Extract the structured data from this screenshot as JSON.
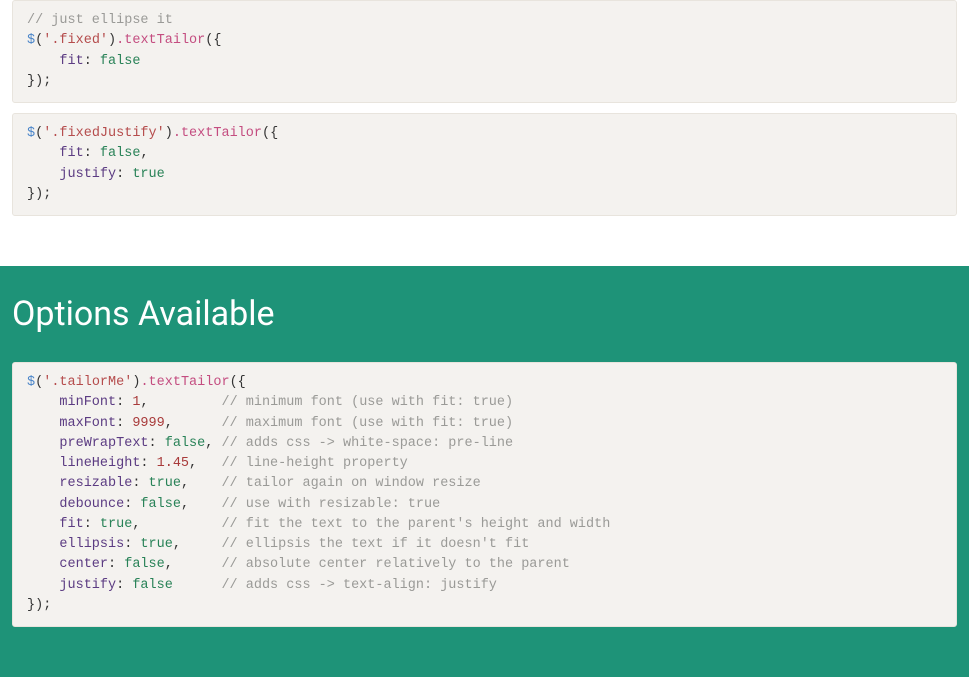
{
  "section_title": "Options Available",
  "code1": {
    "comment": "// just ellipse it",
    "func": "$",
    "selector": "'.fixed'",
    "method": ".textTailor",
    "open": "({",
    "lines": [
      {
        "prop": "fit",
        "val": "false",
        "type": "bool",
        "comma": ""
      }
    ],
    "close": "});"
  },
  "code2": {
    "func": "$",
    "selector": "'.fixedJustify'",
    "method": ".textTailor",
    "open": "({",
    "lines": [
      {
        "prop": "fit",
        "val": "false",
        "type": "bool",
        "comma": ","
      },
      {
        "prop": "justify",
        "val": "true",
        "type": "bool",
        "comma": ""
      }
    ],
    "close": "});"
  },
  "code3": {
    "func": "$",
    "selector": "'.tailorMe'",
    "method": ".textTailor",
    "open": "({",
    "lines": [
      {
        "prop": "minFont",
        "val": "1",
        "type": "num",
        "pad": "        ",
        "comma": ",",
        "comment": "// minimum font (use with fit: true)"
      },
      {
        "prop": "maxFont",
        "val": "9999",
        "type": "num",
        "pad": "     ",
        "comma": ",",
        "comment": "// maximum font (use with fit: true)"
      },
      {
        "prop": "preWrapText",
        "val": "false",
        "type": "bool",
        "pad": "",
        "comma": ",",
        "comment": "// adds css -> white-space: pre-line"
      },
      {
        "prop": "lineHeight",
        "val": "1.45",
        "type": "num",
        "pad": "  ",
        "comma": ",",
        "comment": "// line-height property"
      },
      {
        "prop": "resizable",
        "val": "true",
        "type": "bool",
        "pad": "   ",
        "comma": ",",
        "comment": "// tailor again on window resize"
      },
      {
        "prop": "debounce",
        "val": "false",
        "type": "bool",
        "pad": "   ",
        "comma": ",",
        "comment": "// use with resizable: true"
      },
      {
        "prop": "fit",
        "val": "true",
        "type": "bool",
        "pad": "         ",
        "comma": ",",
        "comment": "// fit the text to the parent's height and width"
      },
      {
        "prop": "ellipsis",
        "val": "true",
        "type": "bool",
        "pad": "    ",
        "comma": ",",
        "comment": "// ellipsis the text if it doesn't fit"
      },
      {
        "prop": "center",
        "val": "false",
        "type": "bool",
        "pad": "     ",
        "comma": ",",
        "comment": "// absolute center relatively to the parent"
      },
      {
        "prop": "justify",
        "val": "false",
        "type": "bool",
        "pad": "    ",
        "comma": "",
        "comment": "// adds css -> text-align: justify"
      }
    ],
    "close": "});"
  }
}
